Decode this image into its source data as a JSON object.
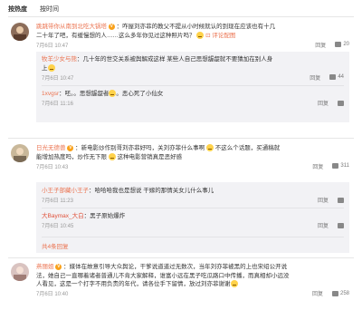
{
  "tabs": [
    "按热度",
    "按时间"
  ],
  "icons": {
    "verified": "V",
    "like": "thumbs-up-icon",
    "link": "link-icon"
  },
  "colors": {
    "username": "#eb7350",
    "meta": "#999999",
    "reply_bg": "#f2f2f5"
  },
  "comments": [
    {
      "user": "跳跳带你从南到北吃大锅塔",
      "text_a": "：咋屋刘亦菲的教父不提从小时候就认的到现在应该也有十几",
      "text_b": "二十年了吧，有缓慢想的人……这么多年你见过这种照片吗？",
      "link_text": "评论配图",
      "time": "7月6日 10:47",
      "reply": "回复",
      "likes": "20",
      "replies": [
        {
          "user": "牧羊少女与熊",
          "text_a": "：几十年的世交关系被舆解成这样 某些人自己思想龌龊就不要猜加在别人身",
          "text_b": "上",
          "time": "7月6日 10:47",
          "reply": "回复",
          "likes": "44"
        },
        {
          "user": "1xvgsr",
          "text_a": "：呸。。思想龌龊者",
          "text_b": "。恶心死了小仙女",
          "time": "7月6日 11:16",
          "reply": "回复",
          "likes": ""
        }
      ]
    },
    {
      "user": "日光无德兽",
      "text_a": "：新电影炒作别哥刘亦菲好吗，关刘亦菲什么事啊",
      "text_a2": "不这么个话题，买通稿就",
      "text_b": "能增加热度吗，炒作无下限",
      "text_b2": "这种电影营销真是恶好感",
      "time": "7月6日 10:43",
      "reply": "回复",
      "likes": "311",
      "replies": [
        {
          "user": "小王子部藏小王子",
          "text_a": "：哈哈哈我也是想说 干嫁的那情关女儿什么事儿",
          "time": "7月6日 11:23",
          "reply": "回复",
          "likes": ""
        },
        {
          "user": "大Baymax_大白",
          "text_a": "：黑子原始爆炸",
          "time": "7月6日 10:45",
          "reply": "回复",
          "likes": ""
        }
      ],
      "more": "共4条回复"
    },
    {
      "user": "燕丽姐",
      "text_a": "：媒体在故意引导大众舆论，干爹说道道过无数次，当年刘亦菲被黑的上也宋绍公开说",
      "text_b": "法，她自己一直哪着诸者普通儿不肯大家解释，谁富小远在黑子吃瓜路口中传播，而真相却小远没",
      "text_c": "人看见，这是一个打字不用负责的年代，请各位手下留情，放过刘亦菲谢谢",
      "time": "7月6日 10:40",
      "reply": "回复",
      "likes": "258"
    }
  ]
}
